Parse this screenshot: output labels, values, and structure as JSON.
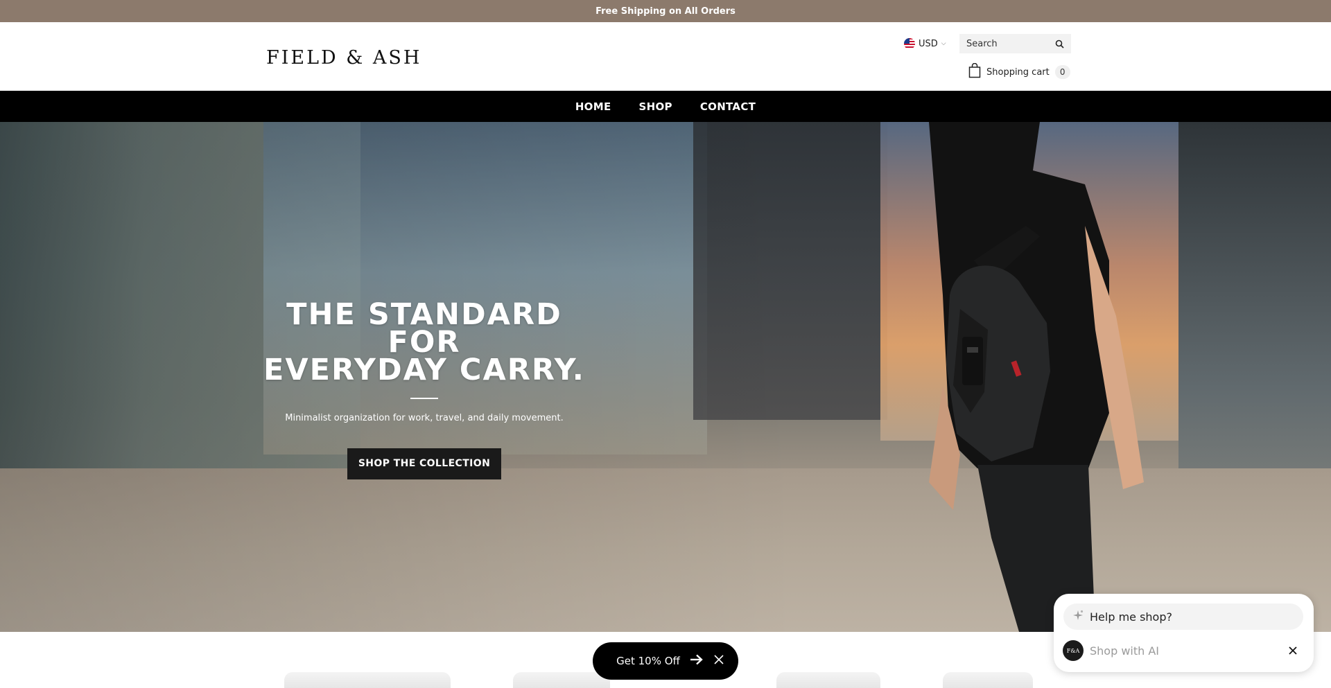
{
  "announcement": {
    "text": "Free Shipping on All Orders"
  },
  "header": {
    "logo": "FIELD & ASH",
    "currency": {
      "code": "USD",
      "flag_icon": "us-flag-icon"
    },
    "search": {
      "placeholder": "Search"
    },
    "cart": {
      "label": "Shopping cart",
      "count": "0"
    }
  },
  "nav": {
    "items": [
      {
        "label": "HOME"
      },
      {
        "label": "SHOP"
      },
      {
        "label": "CONTACT"
      }
    ]
  },
  "hero": {
    "title_line1": "THE STANDARD FOR",
    "title_line2": "EVERYDAY CARRY.",
    "subtitle": "Minimalist organization for work, travel, and daily movement.",
    "cta": "SHOP THE COLLECTION"
  },
  "promo": {
    "label": "Get 10% Off"
  },
  "ai_widget": {
    "prompt": "Help me shop?",
    "avatar_text": "F&A",
    "input_placeholder": "Shop with AI"
  },
  "colors": {
    "announcement_bg": "#8c7a6c",
    "nav_bg": "#000000",
    "button_bg": "#1a1a1a",
    "accent": "#000000"
  }
}
